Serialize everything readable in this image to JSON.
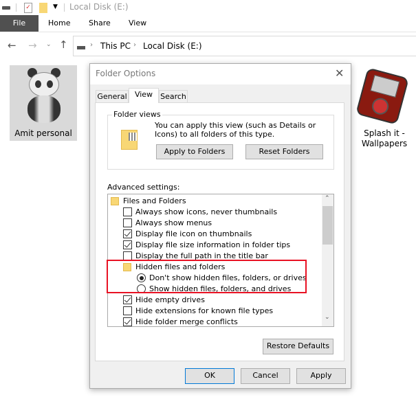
{
  "titlebar": {
    "title": "Local Disk (E:)",
    "icons": [
      "drive-icon",
      "properties-icon",
      "new-folder-icon",
      "customize-dropdown-icon"
    ]
  },
  "ribbon": {
    "tabs": [
      "File",
      "Home",
      "Share",
      "View"
    ]
  },
  "address": {
    "crumbs": [
      "This PC",
      "Local Disk (E:)"
    ]
  },
  "desktop_items": [
    {
      "label": "Amit personal",
      "icon": "panda-icon"
    },
    {
      "label": "Splash it - Wallpapers",
      "icon": "media-player-icon"
    }
  ],
  "dialog": {
    "title": "Folder Options",
    "tabs": [
      "General",
      "View",
      "Search"
    ],
    "active_tab": "View",
    "folder_views": {
      "legend": "Folder views",
      "text": "You can apply this view (such as Details or Icons) to all folders of this type.",
      "apply_label": "Apply to Folders",
      "reset_label": "Reset Folders"
    },
    "advanced_label": "Advanced settings:",
    "settings": [
      {
        "type": "folder",
        "label": "Files and Folders",
        "level": 0
      },
      {
        "type": "checkbox",
        "label": "Always show icons, never thumbnails",
        "checked": false
      },
      {
        "type": "checkbox",
        "label": "Always show menus",
        "checked": false
      },
      {
        "type": "checkbox",
        "label": "Display file icon on thumbnails",
        "checked": true
      },
      {
        "type": "checkbox",
        "label": "Display file size information in folder tips",
        "checked": true
      },
      {
        "type": "checkbox",
        "label": "Display the full path in the title bar",
        "checked": false
      },
      {
        "type": "folder",
        "label": "Hidden files and folders",
        "level": 1
      },
      {
        "type": "radio",
        "label": "Don't show hidden files, folders, or drives",
        "checked": true
      },
      {
        "type": "radio",
        "label": "Show hidden files, folders, and drives",
        "checked": false
      },
      {
        "type": "checkbox",
        "label": "Hide empty drives",
        "checked": true
      },
      {
        "type": "checkbox",
        "label": "Hide extensions for known file types",
        "checked": false
      },
      {
        "type": "checkbox",
        "label": "Hide folder merge conflicts",
        "checked": true
      }
    ],
    "highlight_color": "#e81123",
    "restore_label": "Restore Defaults",
    "ok_label": "OK",
    "cancel_label": "Cancel",
    "apply_label": "Apply"
  }
}
